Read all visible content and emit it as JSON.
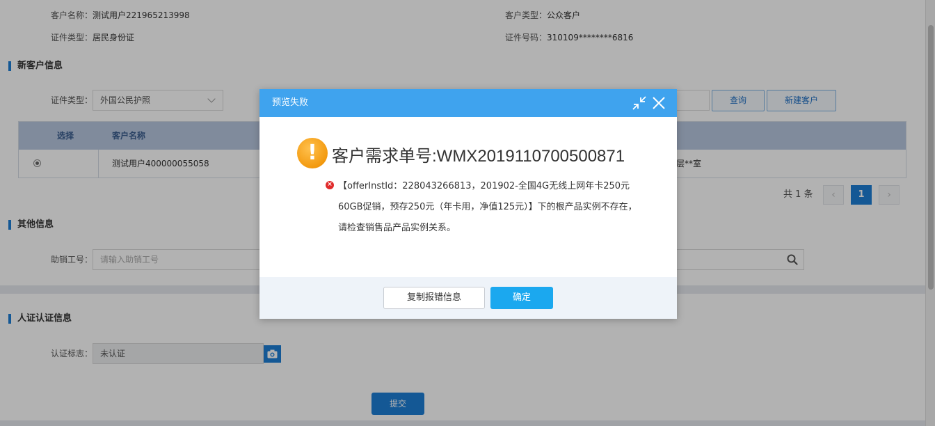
{
  "customer_info": {
    "name_label": "客户名称：",
    "name_value": "测试用户221965213998",
    "type_label": "客户类型：",
    "type_value": "公众客户",
    "cert_type_label": "证件类型：",
    "cert_type_value": "居民身份证",
    "cert_no_label": "证件号码：",
    "cert_no_value": "310109********6816"
  },
  "new_customer": {
    "section_title": "新客户信息",
    "cert_type_label": "证件类型：",
    "cert_type_selected": "外国公民护照",
    "query_button": "查询",
    "new_customer_button": "新建客户",
    "table": {
      "headers": [
        "选择",
        "客户名称"
      ],
      "rows": [
        {
          "name": "测试用户400000055058",
          "address_tail": "层**室"
        }
      ]
    },
    "pager": {
      "total": "共 1 条",
      "current_page": "1",
      "prev": "‹",
      "next": "›"
    }
  },
  "other_info": {
    "section_title": "其他信息",
    "assistant_label": "助销工号：",
    "assistant_placeholder": "请输入助销工号"
  },
  "auth_info": {
    "section_title": "人证认证信息",
    "auth_label": "认证标志：",
    "auth_value": "未认证",
    "submit_button": "提交"
  },
  "dialog": {
    "title": "预览失败",
    "heading": "客户需求单号:WMX2019110700500871",
    "message": "【offerInstId：228043266813，201902-全国4G无线上网年卡250元60GB促销，预存250元（年卡用，净值125元）】下的根产品实例不存在，请检查销售品产品实例关系。",
    "copy_button": "复制报错信息",
    "ok_button": "确定",
    "icons": [
      "warning-icon",
      "error-icon",
      "minimize-icon",
      "close-icon"
    ]
  },
  "colors": {
    "accent": "#1e7ed6",
    "dialog_header": "#3fa3ee",
    "ok_button": "#1ba8ef",
    "error": "#e02b2b",
    "warning": "#f39a0f"
  }
}
